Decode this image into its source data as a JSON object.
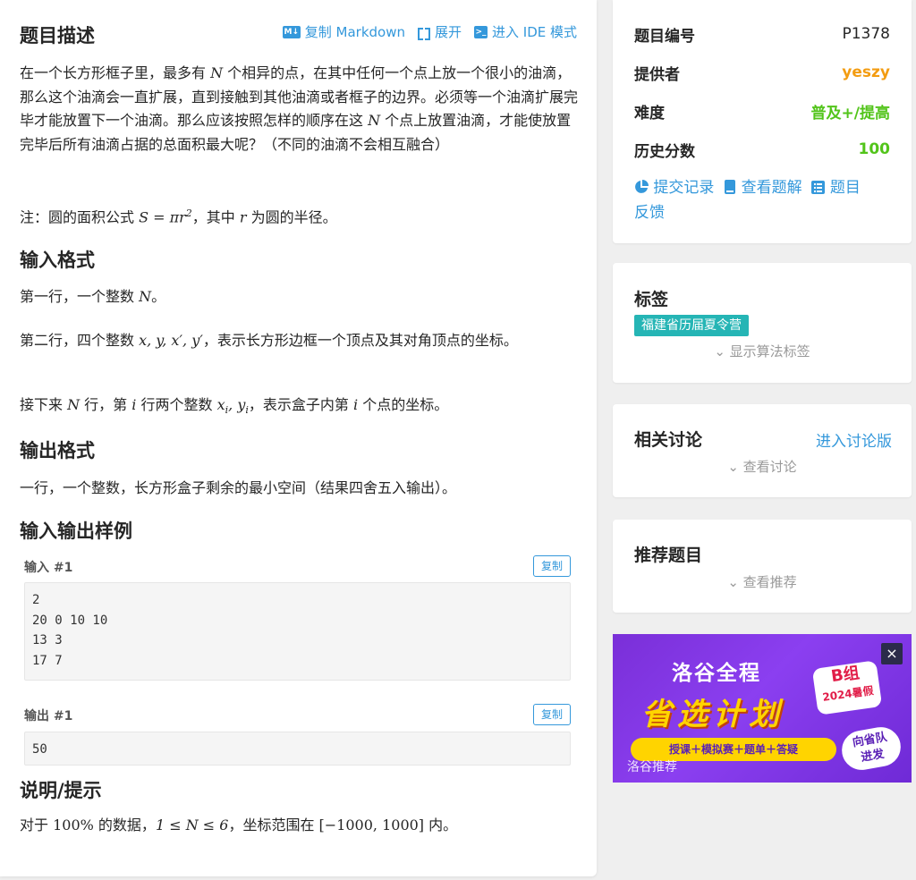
{
  "toolbar": {
    "copy_md": "复制 Markdown",
    "md_icon_text": "M↓",
    "expand": "展开",
    "ide": "进入 IDE 模式",
    "ide_icon_text": ">_"
  },
  "problem": {
    "title": "题目描述",
    "desc_1": "在一个长方形框子里，最多有 ",
    "desc_N": "N",
    "desc_2": " 个相异的点，在其中任何一个点上放一个很小的油滴，那么这个油滴会一直扩展，直到接触到其他油滴或者框子的边界。必须等一个油滴扩展完毕才能放置下一个油滴。那么应该按照怎样的顺序在这 ",
    "desc_N2": "N",
    "desc_3": " 个点上放置油滴，才能使放置完毕后所有油滴占据的总面积最大呢？（不同的油滴不会相互融合）",
    "note_1": "注：圆的面积公式 ",
    "note_formula": "S = πr",
    "note_sup": "2",
    "note_2": "，其中 ",
    "note_r": "r",
    "note_3": " 为圆的半径。",
    "input_title": "输入格式",
    "input_1a": "第一行，一个整数 ",
    "input_1N": "N",
    "input_1b": "。",
    "input_2a": "第二行，四个整数 ",
    "input_2vars": "x, y, x′, y′",
    "input_2b": "，表示长方形边框一个顶点及其对角顶点的坐标。",
    "input_3a": "接下来 ",
    "input_3N": "N",
    "input_3b": " 行，第 ",
    "input_3i": "i",
    "input_3c": " 行两个整数 ",
    "input_3vars": "x",
    "input_3sub1": "i",
    "input_3comma": ", y",
    "input_3sub2": "i",
    "input_3d": "，表示盒子内第 ",
    "input_3i2": "i",
    "input_3e": " 个点的坐标。",
    "output_title": "输出格式",
    "output_1": "一行，一个整数，长方形盒子剩余的最小空间（结果四舍五入输出）。",
    "samples_title": "输入输出样例",
    "input_label": "输入 #1",
    "output_label": "输出 #1",
    "copy": "复制",
    "sample_input": "2\n20 0 10 10\n13 3\n17 7",
    "sample_output": "50",
    "hint_title": "说明/提示",
    "hint_1": "对于 ",
    "hint_pct": "100%",
    "hint_2": " 的数据，",
    "hint_range": "1 ≤ N ≤ 6",
    "hint_3": "，坐标范围在 ",
    "hint_coord": "[−1000, 1000]",
    "hint_4": " 内。"
  },
  "info": {
    "pid_label": "题目编号",
    "pid": "P1378",
    "provider_label": "提供者",
    "provider": "yeszy",
    "provider_color": "#f39c11",
    "difficulty_label": "难度",
    "difficulty": "普及+/提高",
    "difficulty_color": "#52c41a",
    "score_label": "历史分数",
    "score": "100",
    "score_color": "#52c41a",
    "link_submissions": "提交记录",
    "link_solutions": "查看题解",
    "link_feedback_1": "题目",
    "link_feedback_2": "反馈"
  },
  "tags": {
    "title": "标签",
    "tag": "福建省历届夏令营",
    "show_algo": "显示算法标签"
  },
  "discuss": {
    "title": "相关讨论",
    "enter": "进入讨论版",
    "view": "查看讨论"
  },
  "recommend": {
    "title": "推荐题目",
    "view": "查看推荐"
  },
  "ad": {
    "brand": "洛谷全程",
    "headline": "省选计划",
    "badge_1": "B组",
    "badge_2": "2024暑假",
    "subline": "授课＋模拟赛＋题单＋答疑",
    "slogan_1": "向省队",
    "slogan_2": "进发",
    "label": "洛谷推荐",
    "close": "×"
  }
}
